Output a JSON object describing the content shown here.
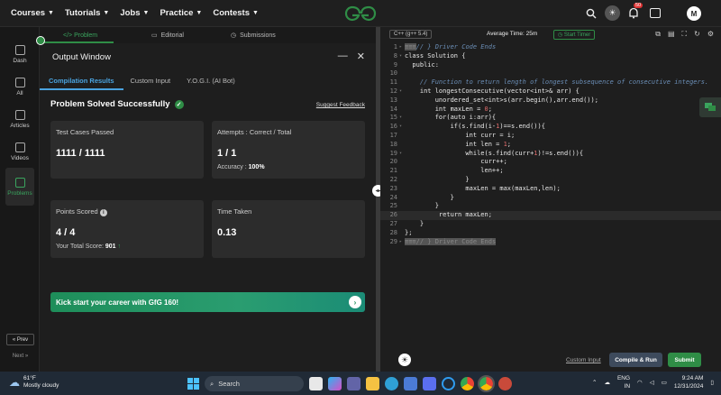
{
  "nav": {
    "items": [
      "Courses",
      "Tutorials",
      "Jobs",
      "Practice",
      "Contests"
    ],
    "notif_count": "50",
    "avatar_letter": "M"
  },
  "sidebar": {
    "items": [
      "Dash",
      "All",
      "Articles",
      "Videos",
      "Problems"
    ],
    "prev": "« Prev",
    "next": "Next »"
  },
  "problem_tabs": [
    "</> Problem",
    "Editorial",
    "Submissions"
  ],
  "output": {
    "title": "Output Window",
    "tabs": [
      "Compilation Results",
      "Custom Input",
      "Y.O.G.I. (AI Bot)"
    ],
    "status": "Problem Solved Successfully",
    "feedback": "Suggest Feedback",
    "cards": {
      "tests_label": "Test Cases Passed",
      "tests_value": "1111 / 1111",
      "attempts_label": "Attempts : Correct / Total",
      "attempts_value": "1 / 1",
      "accuracy_label": "Accuracy :",
      "accuracy_value": "100%",
      "points_label": "Points Scored",
      "points_value": "4 / 4",
      "total_label": "Your Total Score:",
      "total_value": "901",
      "time_label": "Time Taken",
      "time_value": "0.13"
    },
    "banner": "Kick start your career with GfG 160!"
  },
  "editor": {
    "language": "C++ (g++ 5.4)",
    "avg_time": "Average Time: 25m",
    "timer": "Start Timer",
    "custom_input": "Custom Input",
    "compile": "Compile & Run",
    "submit": "Submit"
  },
  "taskbar": {
    "temp": "61°F",
    "weather": "Mostly cloudy",
    "search": "Search",
    "lang1": "ENG",
    "lang2": "IN",
    "time": "9:24 AM",
    "date": "12/31/2024"
  },
  "colors": {
    "accent": "#2f8d46",
    "tab_blue": "#4aa3df",
    "bg": "#1e1e1e"
  }
}
